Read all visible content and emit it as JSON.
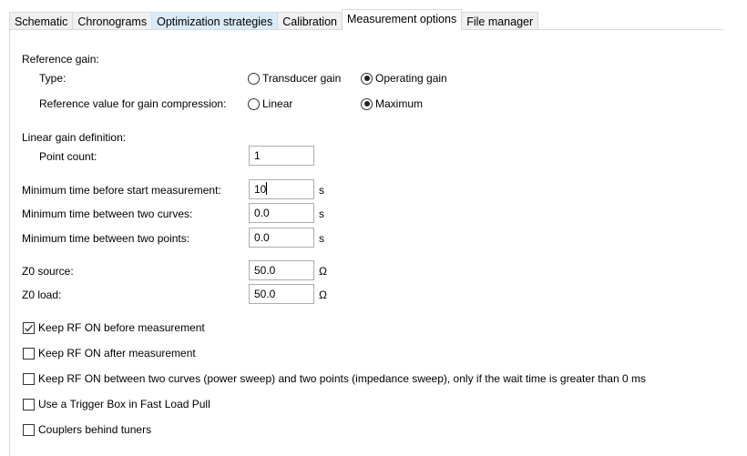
{
  "tabs": [
    {
      "label": "Schematic",
      "state": "normal"
    },
    {
      "label": "Chronograms",
      "state": "normal"
    },
    {
      "label": "Optimization strategies",
      "state": "hover"
    },
    {
      "label": "Calibration",
      "state": "normal"
    },
    {
      "label": "Measurement options",
      "state": "active"
    },
    {
      "label": "File manager",
      "state": "normal"
    }
  ],
  "reference_gain": {
    "heading": "Reference gain:",
    "type_label": "Type:",
    "type_options": [
      {
        "label": "Transducer gain",
        "selected": false
      },
      {
        "label": "Operating gain",
        "selected": true
      }
    ],
    "compression_label": "Reference value for gain compression:",
    "compression_options": [
      {
        "label": "Linear",
        "selected": false
      },
      {
        "label": "Maximum",
        "selected": true
      }
    ]
  },
  "linear_gain": {
    "heading": "Linear gain definition:",
    "point_count_label": "Point count:",
    "point_count_value": "1"
  },
  "timing": [
    {
      "label": "Minimum time before start measurement:",
      "value": "10",
      "unit": "s",
      "focused": true
    },
    {
      "label": "Minimum time between two curves:",
      "value": "0.0",
      "unit": "s",
      "focused": false
    },
    {
      "label": "Minimum time between two points:",
      "value": "0.0",
      "unit": "s",
      "focused": false
    }
  ],
  "impedance": [
    {
      "label": "Z0 source:",
      "value": "50.0",
      "unit": "Ω"
    },
    {
      "label": "Z0 load:",
      "value": "50.0",
      "unit": "Ω"
    }
  ],
  "checkboxes": [
    {
      "label": "Keep RF ON before measurement",
      "checked": true
    },
    {
      "label": "Keep RF ON after measurement",
      "checked": false
    },
    {
      "label": "Keep RF ON between two curves (power sweep) and two points (impedance sweep), only if the wait time is greater than 0 ms",
      "checked": false
    },
    {
      "label": "Use a Trigger Box in Fast Load Pull",
      "checked": false
    },
    {
      "label": "Couplers behind tuners",
      "checked": false
    }
  ]
}
